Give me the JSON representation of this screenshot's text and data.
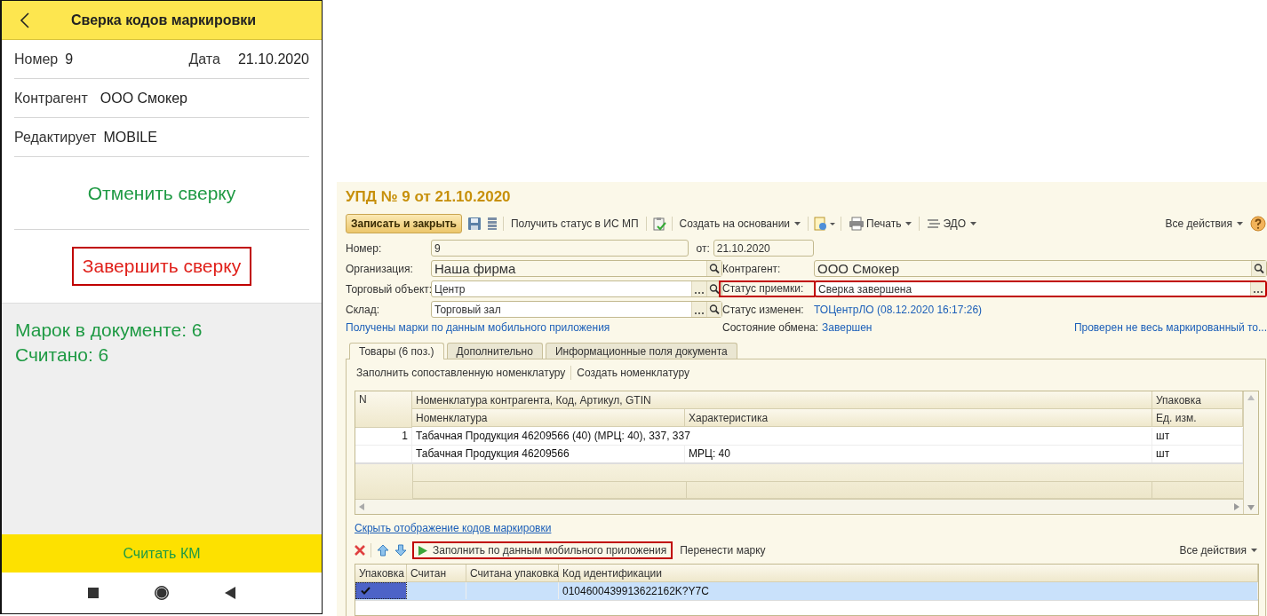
{
  "mobile": {
    "title": "Сверка кодов маркировки",
    "number": {
      "label": "Номер",
      "value": "9"
    },
    "date": {
      "label": "Дата",
      "value": "21.10.2020"
    },
    "rows": [
      {
        "label": "Контрагент",
        "value": "ООО Смокер"
      },
      {
        "label": "Редактирует",
        "value": "MOBILE"
      }
    ],
    "cancel_button": "Отменить сверку",
    "finish_button": {
      "label": "Завершить сверку",
      "highlighted": true
    },
    "summary": [
      "Марок в документе: 6",
      "Считано: 6"
    ],
    "scan_button": "Считать КМ"
  },
  "desktop": {
    "title": "УПД № 9 от 21.10.2020",
    "toolbar": {
      "save_close": "Записать и закрыть",
      "get_status": "Получить статус в ИС МП",
      "create_based": "Создать на основании",
      "print": "Печать",
      "edo": "ЭДО",
      "all_actions": "Все действия"
    },
    "form": {
      "number": {
        "label": "Номер:",
        "value": "9"
      },
      "date": {
        "label": "от:",
        "value": "21.10.2020"
      },
      "organization": {
        "label": "Организация:",
        "value": "Наша фирма"
      },
      "counterparty": {
        "label": "Контрагент:",
        "value": "ООО Смокер"
      },
      "trade_object": {
        "label": "Торговый объект:",
        "value": "Центр"
      },
      "status": {
        "label": "Статус приемки:",
        "value": "Сверка завершена",
        "highlighted": true
      },
      "warehouse": {
        "label": "Склад:",
        "value": "Торговый зал"
      },
      "status_changed": {
        "label": "Статус изменен:",
        "value": "ТОЦентрЛО (08.12.2020 16:17:26)"
      },
      "exchange_state": {
        "label": "Состояние обмена:",
        "value": "Завершен"
      },
      "marks_link": "Получены марки по данным мобильного приложения",
      "check_link": "Проверен не весь маркированный то..."
    },
    "tabs": [
      {
        "label": "Товары (6 поз.)",
        "selected": true
      },
      {
        "label": "Дополнительно",
        "selected": false
      },
      {
        "label": "Информационные поля документа",
        "selected": false
      }
    ],
    "goods_toolbar": [
      "Заполнить сопоставленную номенклатуру",
      "Создать номенклатуру"
    ],
    "goods_table": {
      "header_top": [
        "N",
        "Номенклатура контрагента, Код, Артикул, GTIN",
        "Упаковка"
      ],
      "header_bottom": [
        "Номенклатура",
        "Характеристика",
        "Ед. изм."
      ],
      "rows": [
        {
          "n": "1",
          "counterparty_item": "Табачная Продукция 46209566 (40) (МРЦ: 40), 337, 337",
          "package": "шт",
          "item": "Табачная Продукция 46209566",
          "characteristic": "МРЦ: 40",
          "unit": "шт"
        }
      ]
    },
    "hide_codes_link": "Скрыть отображение кодов маркировки",
    "marks_toolbar": {
      "fill_button": {
        "label": "Заполнить по данным мобильного приложения",
        "highlighted": true
      },
      "move": "Перенести марку",
      "all_actions": "Все действия"
    },
    "marks_table": {
      "columns": [
        "Упаковка",
        "Считан",
        "Считана упаковка",
        "Код идентификации"
      ],
      "rows": [
        {
          "package": true,
          "code": "0104600439913622162K?Y7C",
          "selected": true
        }
      ]
    }
  }
}
